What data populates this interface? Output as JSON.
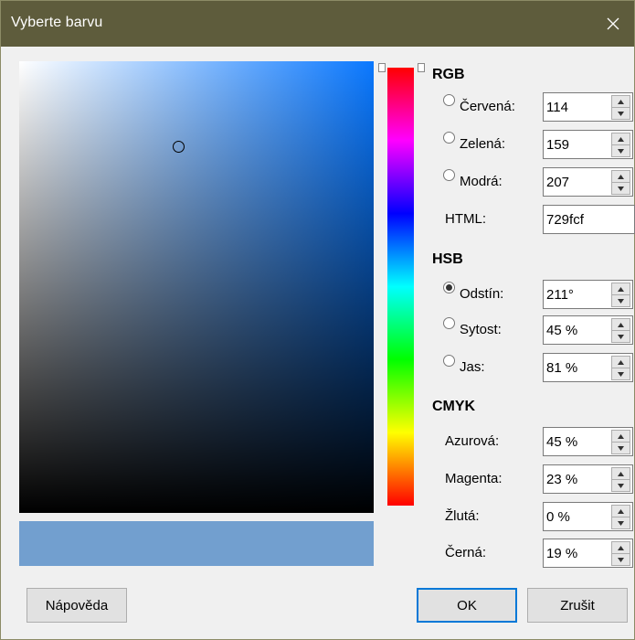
{
  "window": {
    "title": "Vyberte barvu"
  },
  "icons": {
    "close": "close-icon",
    "up": "up-arrow-icon",
    "down": "down-arrow-icon"
  },
  "colors": {
    "selected": "#729fcf",
    "field_hue": "#0a78ff"
  },
  "rgb": {
    "heading": "RGB",
    "red": {
      "label": "Červená:",
      "value": "114"
    },
    "green": {
      "label": "Zelená:",
      "value": "159"
    },
    "blue": {
      "label": "Modrá:",
      "value": "207"
    },
    "html": {
      "label": "HTML:",
      "value": "729fcf"
    }
  },
  "hsb": {
    "heading": "HSB",
    "hue": {
      "label": "Odstín:",
      "value": "211°",
      "selected": true
    },
    "saturation": {
      "label": "Sytost:",
      "value": "45 %"
    },
    "brightness": {
      "label": "Jas:",
      "value": "81 %"
    }
  },
  "cmyk": {
    "heading": "CMYK",
    "cyan": {
      "label": "Azurová:",
      "value": "45 %"
    },
    "magenta": {
      "label": "Magenta:",
      "value": "23 %"
    },
    "yellow": {
      "label": "Žlutá:",
      "value": "0 %"
    },
    "black": {
      "label": "Černá:",
      "value": "19 %"
    }
  },
  "buttons": {
    "help": "Nápověda",
    "ok": "OK",
    "cancel": "Zrušit"
  }
}
